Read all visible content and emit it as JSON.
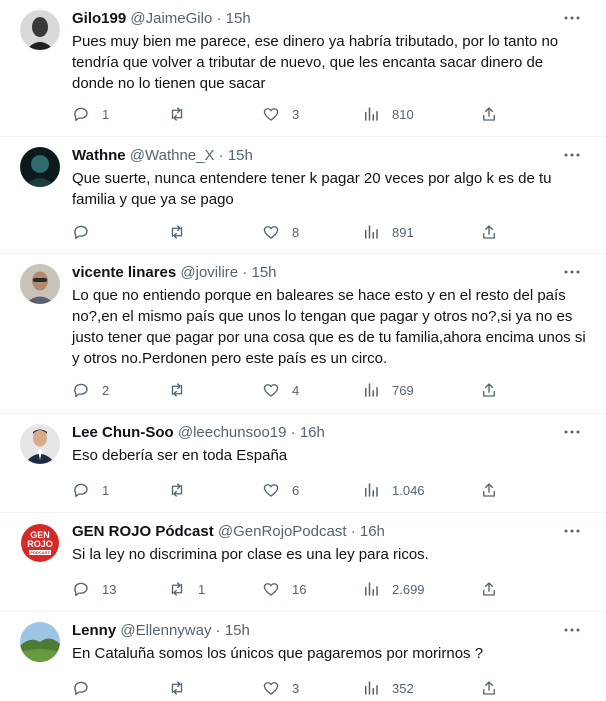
{
  "tweets": [
    {
      "name": "Gilo199",
      "handle": "@JaimeGilo",
      "dot": "·",
      "time": "15h",
      "text": "Pues muy bien me parece, ese dinero ya habría tributado, por lo tanto no tendría que volver a tributar de nuevo, que les encanta sacar dinero de donde no lo tienen que sacar",
      "replies": "1",
      "retweets": "",
      "likes": "3",
      "views": "810",
      "avatar_color": "#3a3a3a"
    },
    {
      "name": "Wathne",
      "handle": "@Wathne_X",
      "dot": "·",
      "time": "15h",
      "text": "Que suerte, nunca entendere tener k pagar 20 veces por algo k es de tu familia y que ya se pago",
      "replies": "",
      "retweets": "",
      "likes": "8",
      "views": "891",
      "avatar_color": "#1c3d40"
    },
    {
      "name": "vicente linares",
      "handle": "@jovilire",
      "dot": "·",
      "time": "15h",
      "text": "Lo que no entiendo porque en baleares se hace esto y en el resto del país no?,en el mismo país que unos lo tengan que pagar y otros no?,si ya no es justo tener que pagar por una cosa que es de tu familia,ahora encima unos si y otros no.Perdonen pero este país es un circo.",
      "replies": "2",
      "retweets": "",
      "likes": "4",
      "views": "769",
      "avatar_color": "#8a7a6a"
    },
    {
      "name": "Lee Chun-Soo",
      "handle": "@leechunsoo19",
      "dot": "·",
      "time": "16h",
      "text": "Eso debería ser en toda España",
      "replies": "1",
      "retweets": "",
      "likes": "6",
      "views": "1.046",
      "avatar_color": "#2a3550"
    },
    {
      "name": "GEN ROJO Pódcast",
      "handle": "@GenRojoPodcast",
      "dot": "·",
      "time": "16h",
      "text": "Si la ley no discrimina por clase es una ley para ricos.",
      "replies": "13",
      "retweets": "1",
      "likes": "16",
      "views": "2.699",
      "avatar_color": "#d42a2a",
      "avatar_lines": [
        "GEN",
        "ROJO",
        "PÓDCAST"
      ]
    },
    {
      "name": "Lenny",
      "handle": "@Ellennyway",
      "dot": "·",
      "time": "15h",
      "text": "En Cataluña somos los únicos que pagaremos por morirnos ?",
      "replies": "",
      "retweets": "",
      "likes": "3",
      "views": "352",
      "avatar_color": "#5a8a3a"
    }
  ],
  "icons": {
    "reply": "reply-icon",
    "retweet": "retweet-icon",
    "like": "heart-icon",
    "views": "views-icon",
    "share": "share-icon",
    "more": "more-icon"
  }
}
